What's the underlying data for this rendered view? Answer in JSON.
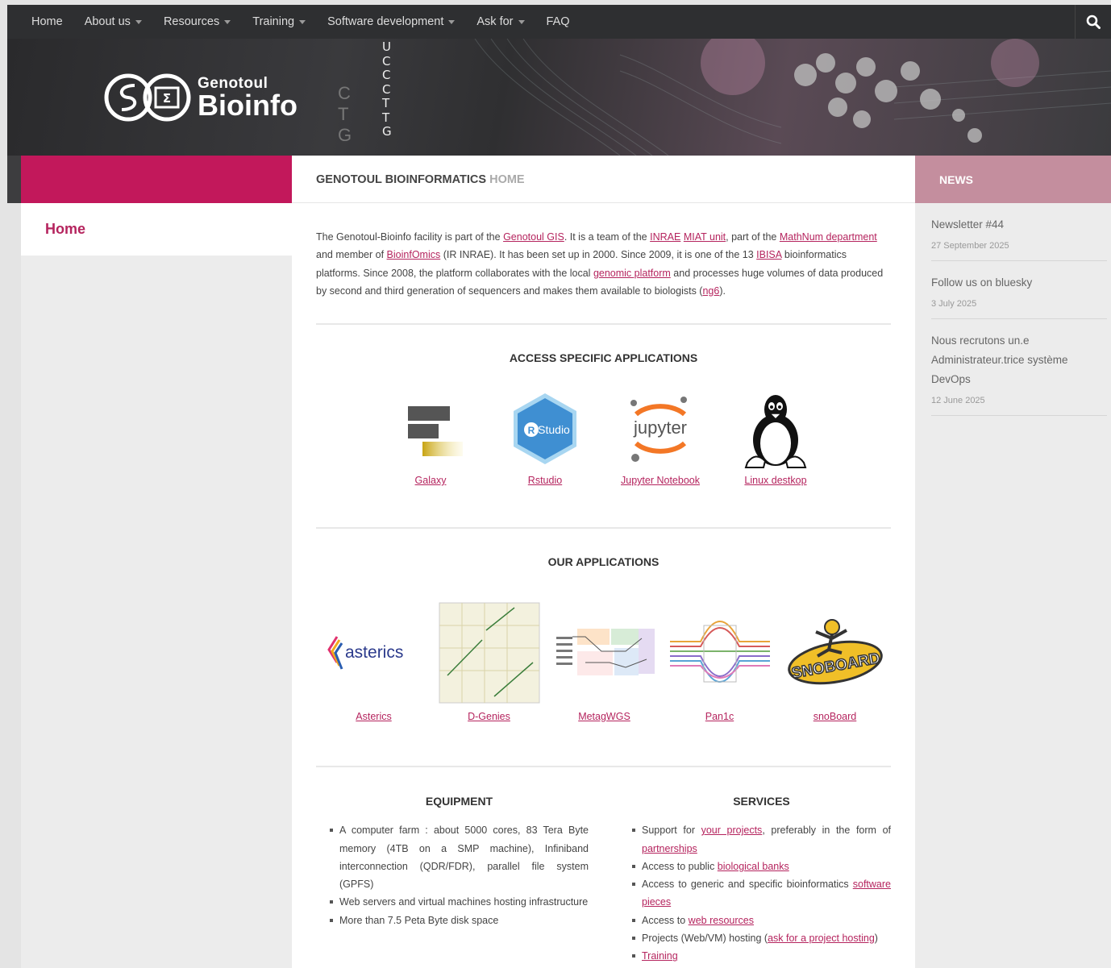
{
  "nav": {
    "items": [
      {
        "label": "Home",
        "dropdown": false
      },
      {
        "label": "About us",
        "dropdown": true
      },
      {
        "label": "Resources",
        "dropdown": true
      },
      {
        "label": "Training",
        "dropdown": true
      },
      {
        "label": "Software development",
        "dropdown": true
      },
      {
        "label": "Ask for",
        "dropdown": true
      },
      {
        "label": "FAQ",
        "dropdown": false
      }
    ],
    "search_icon": "search-icon"
  },
  "header": {
    "logo_small": "Genotoul",
    "logo_big": "Bioinfo",
    "dna_letters": [
      "U",
      "C",
      "C",
      "C",
      "T",
      "T",
      "G"
    ],
    "bg_letters": [
      "C",
      "T",
      "G"
    ]
  },
  "sidebar": {
    "home_label": "Home"
  },
  "main": {
    "title_strong": "GENOTOUL BIOINFORMATICS",
    "title_light": "HOME",
    "intro": {
      "t1": "The Genotoul-Bioinfo facility is part of the ",
      "l1": "Genotoul GIS",
      "t2": ". It is a team of the ",
      "l2": "INRAE",
      "t3": " ",
      "l3": "MIAT unit",
      "t4": ", part of the ",
      "l4": "MathNum department",
      "t5": " and member of ",
      "l5": "BioinfOmics",
      "t6": " (IR INRAE). It has been set up in 2000. Since 2009, it is one of the 13 ",
      "l6": "IBISA",
      "t7": " bioinformatics platforms. Since 2008, the platform collaborates with the local ",
      "l7": "genomic platform",
      "t8": " and processes huge volumes of data produced by second and third generation of sequencers and makes them available to biologists (",
      "l8": "ng6",
      "t9": ")."
    },
    "access_title": "ACCESS SPECIFIC APPLICATIONS",
    "access_apps": [
      {
        "label": "Galaxy",
        "icon": "galaxy-icon"
      },
      {
        "label": "Rstudio",
        "icon": "rstudio-icon",
        "icon_text": "Studio",
        "icon_letter": "R"
      },
      {
        "label": "Jupyter Notebook",
        "icon": "jupyter-icon",
        "icon_text": "jupyter"
      },
      {
        "label": "Linux destkop",
        "icon": "linux-tux-icon"
      }
    ],
    "our_title": "OUR APPLICATIONS",
    "our_apps": [
      {
        "label": "Asterics",
        "icon": "asterics-logo",
        "icon_text": "asterics"
      },
      {
        "label": "D-Genies",
        "icon": "dgenies-dotplot-image"
      },
      {
        "label": "MetagWGS",
        "icon": "metagwgs-workflow-image"
      },
      {
        "label": "Pan1c",
        "icon": "pan1c-graph-image"
      },
      {
        "label": "snoBoard",
        "icon": "snoboard-logo",
        "icon_text": "SNOBOARD"
      }
    ],
    "equipment": {
      "title": "EQUIPMENT",
      "items": [
        "A computer farm : about 5000 cores, 83 Tera Byte memory (4TB on a SMP machine), Infiniband interconnection (QDR/FDR), parallel file system (GPFS)",
        "Web servers and virtual machines hosting infrastructure",
        "More than 7.5 Peta Byte disk space"
      ]
    },
    "services": {
      "title": "SERVICES",
      "s1": {
        "t1": "Support for ",
        "l1": "your projects",
        "t2": ", preferably in the form of ",
        "l2": "partnerships"
      },
      "s2": {
        "t1": "Access to public ",
        "l1": "biological banks"
      },
      "s3": {
        "t1": "Access to generic and specific bioinformatics ",
        "l1": "software pieces"
      },
      "s4": {
        "t1": "Access to ",
        "l1": "web resources"
      },
      "s5": {
        "t1": "Projects (Web/VM) hosting (",
        "l1": "ask for a project hosting",
        "t2": ")"
      },
      "s6": {
        "l1": "Training"
      }
    }
  },
  "news": {
    "title": "NEWS",
    "items": [
      {
        "title": "Newsletter #44",
        "date": "27 September 2025"
      },
      {
        "title": "Follow us on bluesky",
        "date": "3 July 2025"
      },
      {
        "title": "Nous recrutons un.e Administrateur.trice système DevOps",
        "date": "12 June 2025"
      }
    ]
  },
  "colors": {
    "nav_bg": "#2e2f31",
    "accent": "#c2185b",
    "link": "#b5245e",
    "news_bar": "#c48e9e"
  }
}
